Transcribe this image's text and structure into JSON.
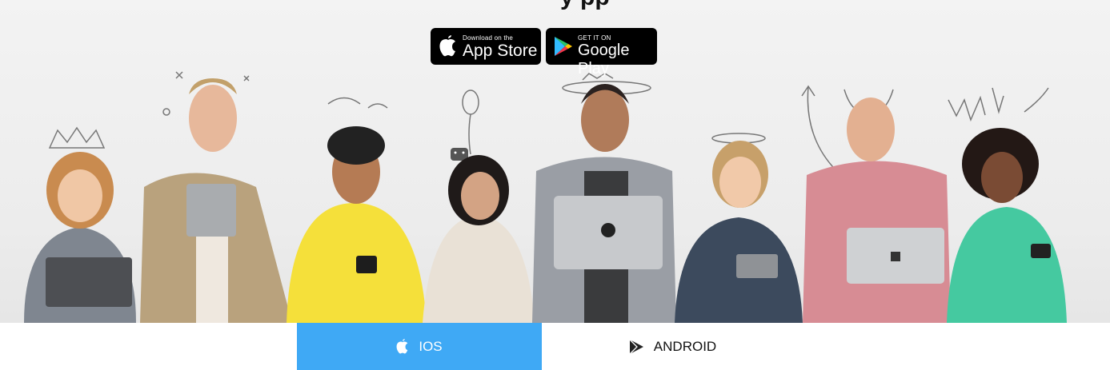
{
  "header": {
    "title_fragment": "y    pp"
  },
  "store_badges": {
    "app_store": {
      "small": "Download on the",
      "large": "App Store",
      "icon": "apple-icon"
    },
    "google_play": {
      "small": "GET IT ON",
      "large": "Google Play",
      "icon": "google-play-icon"
    }
  },
  "tabs": [
    {
      "label": "IOS",
      "icon": "apple-icon",
      "active": true
    },
    {
      "label": "ANDROID",
      "icon": "play-icon",
      "active": false
    }
  ],
  "colors": {
    "active_tab": "#3fa9f5",
    "badge_bg": "#000000"
  }
}
